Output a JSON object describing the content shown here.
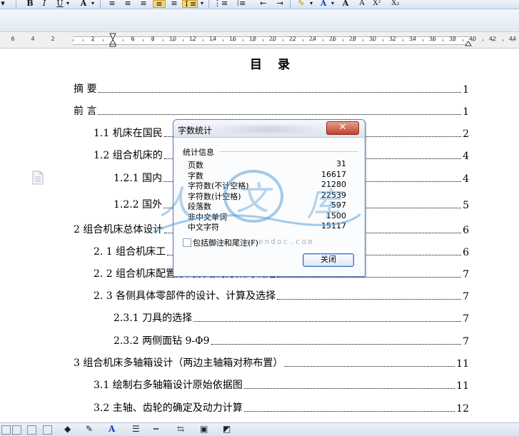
{
  "toolbar": {
    "bold": "B",
    "italic": "I",
    "underline": "U",
    "font_color": "A",
    "font_size_large": "A",
    "font_size_small": "A",
    "superscript": "X²",
    "subscript": "X₂"
  },
  "ruler": {
    "left_numbers": [
      "6",
      "4",
      "2"
    ],
    "numbers": [
      "2",
      "2",
      "6",
      "8",
      "10",
      "12",
      "14",
      "16",
      "18",
      "20",
      "22",
      "24",
      "26",
      "28",
      "30",
      "32",
      "34",
      "36",
      "38",
      "40",
      "42",
      "44"
    ]
  },
  "document": {
    "title": "目 录",
    "toc": [
      {
        "label": "摘    要",
        "page": "1"
      },
      {
        "label": "前    言",
        "page": "1"
      },
      {
        "label": "1.1 机床在国民",
        "page": "2"
      },
      {
        "label": "1.2  组合机床的",
        "page": "4"
      },
      {
        "label": "1.2.1  国内",
        "page": "4"
      },
      {
        "label": "1.2.2  国外",
        "page": "5"
      },
      {
        "label": "2 组合机床总体设计",
        "page": "6"
      },
      {
        "label": "2. 1 组合机床工",
        "page": "6"
      },
      {
        "label": "2. 2 组合机床配置形式及结构方案的确定",
        "page": "7"
      },
      {
        "label": "2. 3 各侧具体零部件的设计、计算及选择",
        "page": "7"
      },
      {
        "label": "2.3.1 刀具的选择",
        "page": "7"
      },
      {
        "label": "2.3.2 两侧面钻 9-Φ9",
        "page": "7"
      },
      {
        "label": "3 组合机床多轴箱设计（两边主轴箱对称布置）",
        "page": "11"
      },
      {
        "label": "3.1 绘制右多轴箱设计原始依据图",
        "page": "11"
      },
      {
        "label": "3.2 主轴、齿轮的确定及动力计算",
        "page": "12"
      }
    ]
  },
  "dialog": {
    "title": "字数统计",
    "close_glyph": "✕",
    "group_label": "统计信息",
    "stats": [
      {
        "label": "页数",
        "value": "31"
      },
      {
        "label": "字数",
        "value": "16617"
      },
      {
        "label": "字符数(不计空格)",
        "value": "21280"
      },
      {
        "label": "字符数(计空格)",
        "value": "22539"
      },
      {
        "label": "段落数",
        "value": "597"
      },
      {
        "label": "非中文单词",
        "value": "1500"
      },
      {
        "label": "中文字符",
        "value": "15117"
      }
    ],
    "checkbox_label": "包括脚注和尾注(F)",
    "checkbox_checked": false,
    "close_button": "关闭"
  },
  "watermark": {
    "text_chars": "人 文 库",
    "url": "www.renrendoc.com"
  },
  "colors": {
    "accent": "#3c6fbf",
    "close_red": "#c2402a",
    "watermark": "#5aa0d8"
  }
}
